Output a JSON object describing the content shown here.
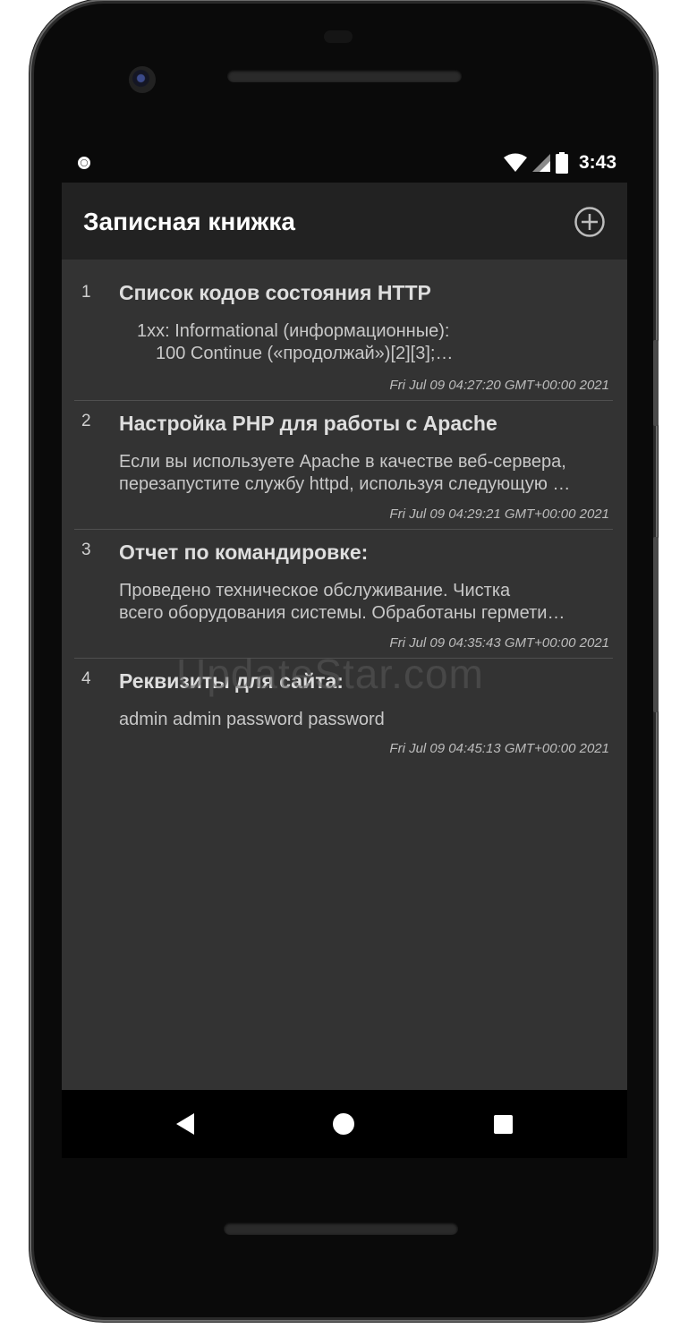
{
  "status_bar": {
    "time": "3:43"
  },
  "app_bar": {
    "title": "Записная книжка",
    "add_icon": "plus-circle-icon"
  },
  "notes": [
    {
      "number": "1",
      "title": "Список кодов состояния HTTP",
      "body_lines": [
        "1xx: Informational (информационные):",
        "100 Continue («продолжай»)[2][3];…"
      ],
      "date": "Fri Jul 09 04:27:20 GMT+00:00 2021"
    },
    {
      "number": "2",
      "title": "Настройка PHP для работы с Apache",
      "body_lines": [
        "Если вы используете Apache в качестве веб-сервера,",
        "перезапустите службу httpd, используя следующую …"
      ],
      "date": "Fri Jul 09 04:29:21 GMT+00:00 2021"
    },
    {
      "number": "3",
      "title": "Отчет по командировке:",
      "body_lines": [
        "Проведено техническое обслуживание. Чистка",
        "всего оборудования системы. Обработаны гермети…"
      ],
      "date": "Fri Jul 09 04:35:43 GMT+00:00 2021"
    },
    {
      "number": "4",
      "title": "Реквизиты для сайта:",
      "body_lines": [
        "admin admin password password"
      ],
      "date": "Fri Jul 09 04:45:13 GMT+00:00 2021"
    }
  ],
  "watermark": "UpdateStar.com",
  "colors": {
    "screen_bg": "#333333",
    "app_bar_bg": "#222222",
    "text_primary": "#dedede"
  }
}
